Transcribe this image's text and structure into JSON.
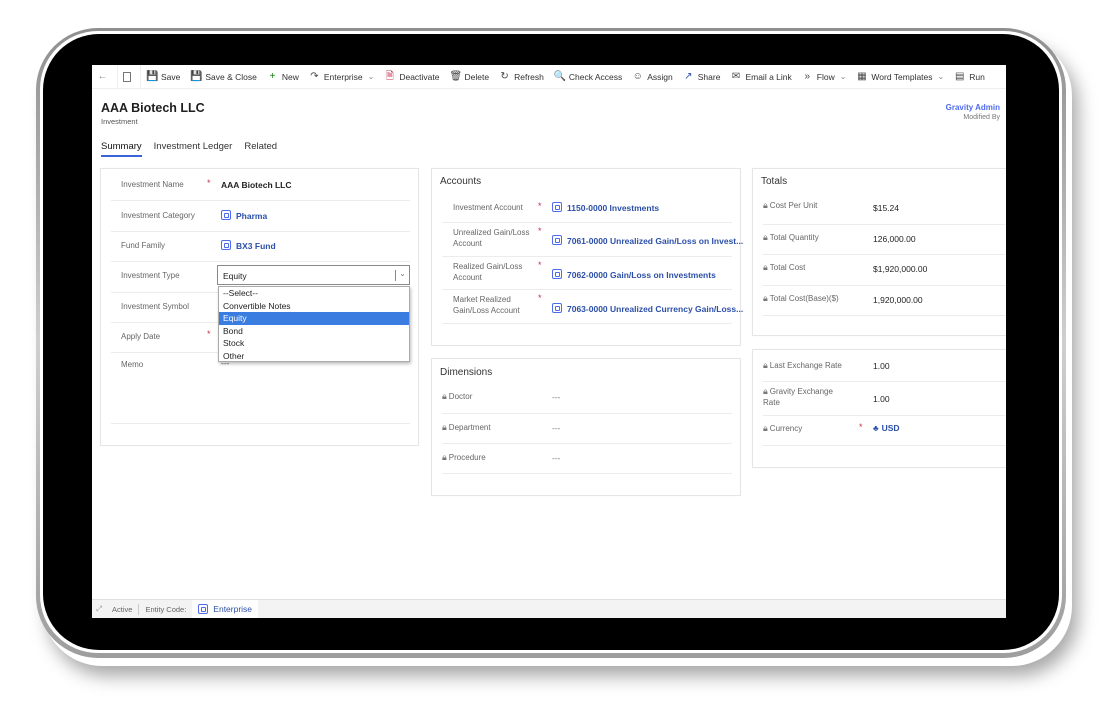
{
  "toolbar": {
    "back": "back",
    "items": [
      {
        "label": "Save",
        "icon": "save-icon"
      },
      {
        "label": "Save & Close",
        "icon": "save-close-icon"
      },
      {
        "label": "New",
        "icon": "plus-icon"
      },
      {
        "label": "Enterprise",
        "icon": "enterprise-icon",
        "dropdown": true
      },
      {
        "label": "Deactivate",
        "icon": "deactivate-icon"
      },
      {
        "label": "Delete",
        "icon": "delete-icon"
      },
      {
        "label": "Refresh",
        "icon": "refresh-icon"
      },
      {
        "label": "Check Access",
        "icon": "check-access-icon"
      },
      {
        "label": "Assign",
        "icon": "assign-icon"
      },
      {
        "label": "Share",
        "icon": "share-icon"
      },
      {
        "label": "Email a Link",
        "icon": "email-icon"
      },
      {
        "label": "Flow",
        "icon": "flow-icon",
        "dropdown": true
      },
      {
        "label": "Word Templates",
        "icon": "word-icon",
        "dropdown": true
      },
      {
        "label": "Run",
        "icon": "run-report-icon"
      }
    ]
  },
  "header": {
    "title": "AAA  Biotech LLC",
    "entity": "Investment",
    "owner_name": "Gravity Admin",
    "owner_label": "Modified By"
  },
  "tabs": [
    "Summary",
    "Investment Ledger",
    "Related"
  ],
  "active_tab": "Summary",
  "general": {
    "fields": [
      {
        "label": "Investment Name",
        "required": true,
        "value": "AAA  Biotech LLC"
      },
      {
        "label": "Investment Category",
        "required": false,
        "value": "Pharma",
        "lookup": true
      },
      {
        "label": "Fund Family",
        "required": false,
        "value": "BX3 Fund",
        "lookup": true
      },
      {
        "label": "Investment Type",
        "required": false,
        "value": "Equity"
      },
      {
        "label": "Investment Symbol",
        "required": false,
        "value": ""
      },
      {
        "label": "Apply Date",
        "required": true,
        "value": ""
      },
      {
        "label": "Memo",
        "required": false,
        "value": "---"
      }
    ],
    "investment_type_options": [
      "--Select--",
      "Convertible Notes",
      "Equity",
      "Bond",
      "Stock",
      "Other"
    ],
    "investment_type_highlighted": "Equity"
  },
  "accounts": {
    "title": "Accounts",
    "fields": [
      {
        "label": "Investment Account",
        "required": true,
        "value": "1150-0000 Investments"
      },
      {
        "label": "Unrealized Gain/Loss Account",
        "required": true,
        "value": "7061-0000 Unrealized Gain/Loss on Invest..."
      },
      {
        "label": "Realized Gain/Loss Account",
        "required": true,
        "value": "7062-0000 Gain/Loss on Investments"
      },
      {
        "label": "Market Realized Gain/Loss Account",
        "required": true,
        "value": "7063-0000 Unrealized Currency Gain/Loss..."
      }
    ]
  },
  "dimensions": {
    "title": "Dimensions",
    "fields": [
      {
        "label": "Doctor",
        "value": "---"
      },
      {
        "label": "Department",
        "value": "---"
      },
      {
        "label": "Procedure",
        "value": "---"
      }
    ]
  },
  "totals": {
    "title": "Totals",
    "fields": [
      {
        "label": "Cost Per Unit",
        "value": "$15.24"
      },
      {
        "label": "Total Quantity",
        "value": "126,000.00"
      },
      {
        "label": "Total Cost",
        "value": "$1,920,000.00"
      },
      {
        "label": "Total Cost(Base)($)",
        "value": "1,920,000.00"
      }
    ]
  },
  "exchange": {
    "fields": [
      {
        "label": "Last Exchange Rate",
        "value": "1.00"
      },
      {
        "label": "Gravity Exchange Rate",
        "value": "1.00"
      },
      {
        "label": "Currency",
        "value": "USD",
        "required": true
      }
    ]
  },
  "statusbar": {
    "status": "Active",
    "entity_code_label": "Entity Code:",
    "entity_code_value": "Enterprise"
  }
}
